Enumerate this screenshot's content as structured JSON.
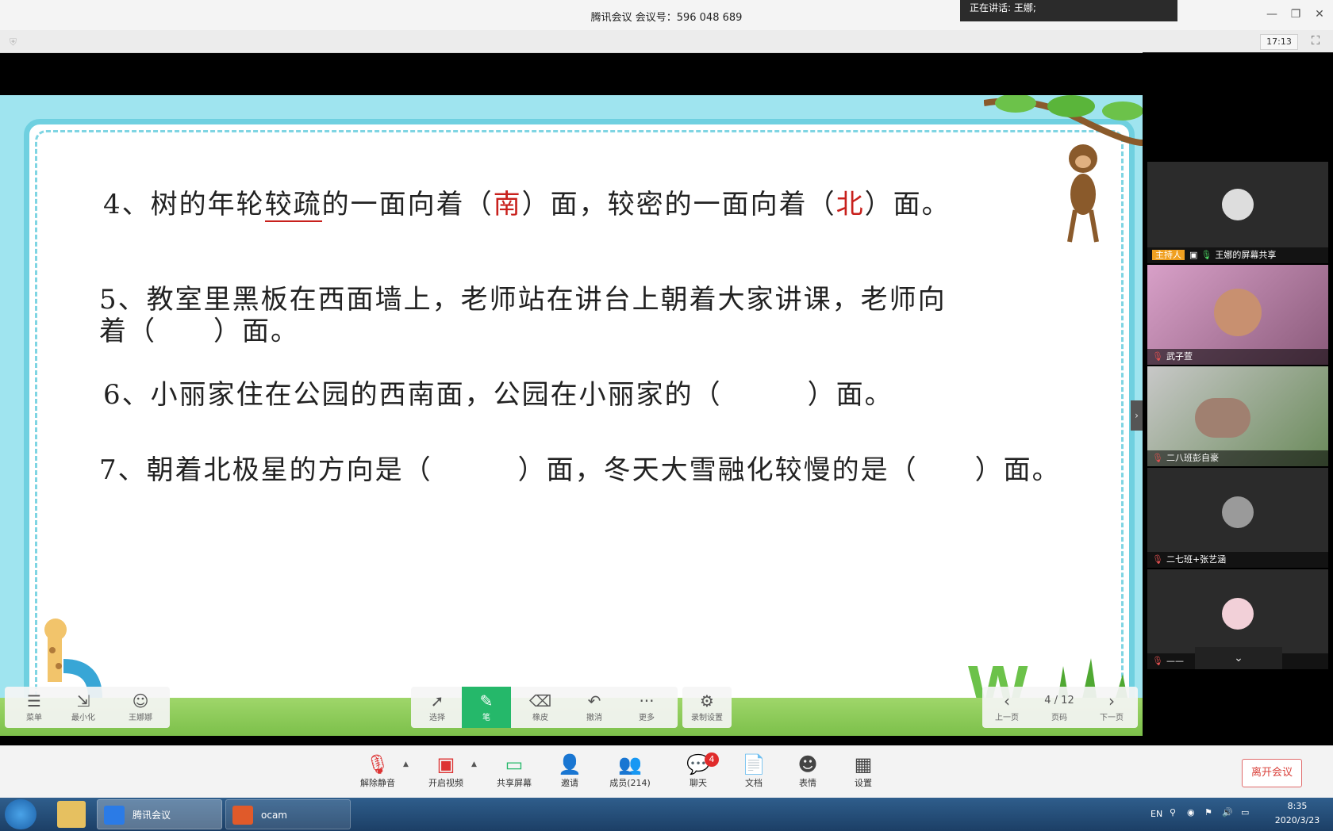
{
  "window": {
    "title": "腾讯会议 会议号：596 048 689",
    "speaking": "正在讲话: 王娜;",
    "time": "17:13"
  },
  "slide": {
    "q4": {
      "prefix": "4、树的年轮",
      "underlined": "较疏",
      "mid1": "的一面向着（",
      "ans1": "南",
      "mid2": "）面，较密的一面向着（",
      "ans2": "北",
      "suffix": "）面。"
    },
    "q5": {
      "line1": "5、教室里黑板在西面墙上，老师站在讲台上朝着大家讲课，老师向",
      "line2": "着（　　）面。"
    },
    "q6": "6、小丽家住在公园的西南面，公园在小丽家的（　　　）面。",
    "q7": "7、朝着北极星的方向是（　　　）面，冬天大雪融化较慢的是（　　）面。"
  },
  "left_tools": [
    {
      "icon": "menu-icon",
      "label": "菜单"
    },
    {
      "icon": "minimize-icon",
      "label": "最小化"
    },
    {
      "icon": "user-avatar-icon",
      "label": "王娜娜"
    }
  ],
  "draw_tools": [
    {
      "icon": "cursor-icon",
      "label": "选择"
    },
    {
      "icon": "pen-icon",
      "label": "笔"
    },
    {
      "icon": "eraser-icon",
      "label": "橡皮"
    },
    {
      "icon": "undo-icon",
      "label": "撤消"
    },
    {
      "icon": "more-icon",
      "label": "更多"
    }
  ],
  "record": {
    "icon": "record-settings-icon",
    "label": "录制设置"
  },
  "pager": {
    "prev_label": "上一页",
    "page": "4 / 12",
    "page_label": "页码",
    "next_label": "下一页"
  },
  "participants": [
    {
      "name": "王娜的屏幕共享",
      "role": "主持人"
    },
    {
      "name": "武子萱"
    },
    {
      "name": "二八班彭自豪"
    },
    {
      "name": "二七班+张艺涵"
    },
    {
      "name": "——"
    }
  ],
  "meeting_toolbar": [
    {
      "icon": "mic-muted-icon",
      "label": "解除静音"
    },
    {
      "icon": "camera-off-icon",
      "label": "开启视频"
    },
    {
      "icon": "screen-share-icon",
      "label": "共享屏幕"
    },
    {
      "icon": "invite-icon",
      "label": "邀请"
    },
    {
      "icon": "members-icon",
      "label": "成员(214)"
    },
    {
      "icon": "chat-icon",
      "label": "聊天"
    },
    {
      "icon": "document-icon",
      "label": "文档"
    },
    {
      "icon": "emoji-icon",
      "label": "表情"
    },
    {
      "icon": "settings-icon",
      "label": "设置"
    }
  ],
  "chat_badge": "4",
  "leave_label": "离开会议",
  "taskbar": {
    "apps": [
      {
        "label": "腾讯会议"
      },
      {
        "label": "ocam"
      }
    ],
    "lang": "EN",
    "clock_time": "8:35",
    "clock_date": "2020/3/23"
  }
}
